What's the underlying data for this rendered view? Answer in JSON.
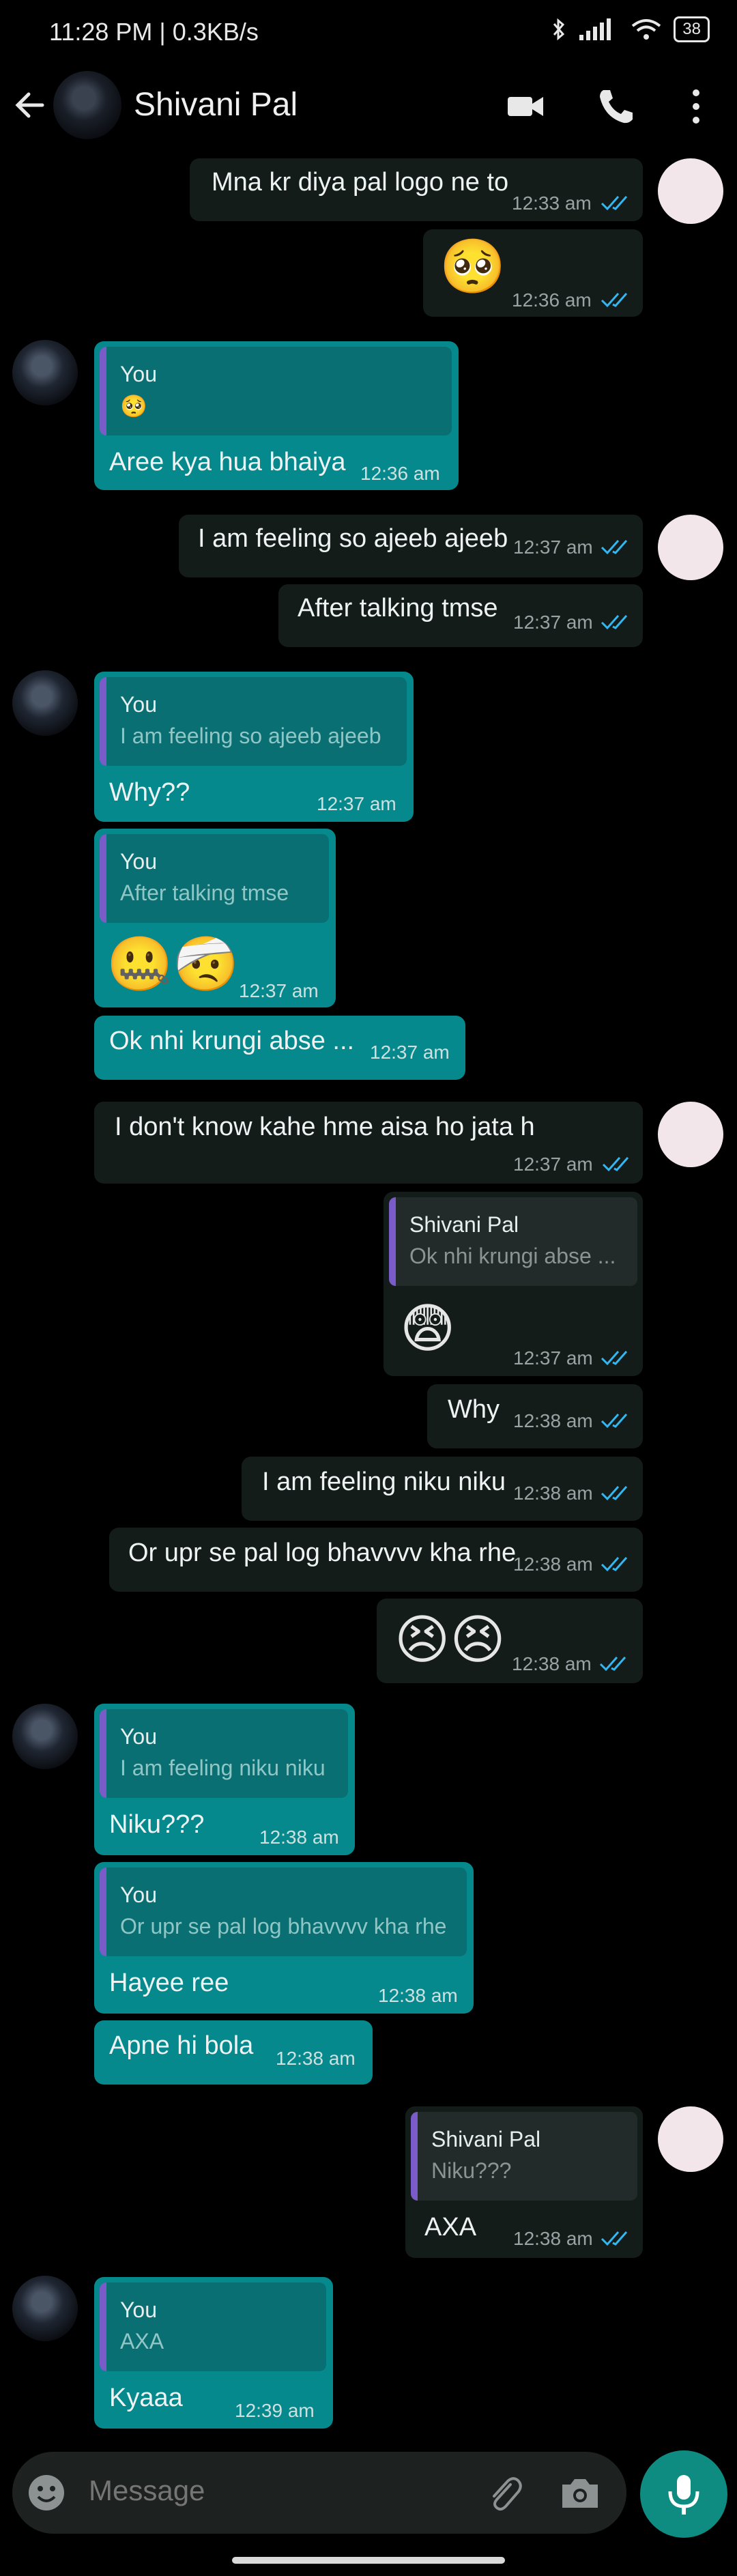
{
  "status_bar": {
    "time": "11:28 PM | 0.3KB/s",
    "battery": "38"
  },
  "header": {
    "contact_name": "Shivani Pal"
  },
  "messages": [
    {
      "text": "Mna kr diya pal logo ne to",
      "time": "12:33 am"
    },
    {
      "emoji": "🥺",
      "time": "12:36 am"
    },
    {
      "quote_name": "You",
      "quote_text": "🥺",
      "text": "Aree kya hua bhaiya",
      "time": "12:36 am"
    },
    {
      "text": "I am feeling so ajeeb ajeeb",
      "time": "12:37 am"
    },
    {
      "text": "After talking tmse",
      "time": "12:37 am"
    },
    {
      "quote_name": "You",
      "quote_text": "I am feeling so ajeeb ajeeb",
      "text": "Why??",
      "time": "12:37 am"
    },
    {
      "quote_name": "You",
      "quote_text": "After talking tmse",
      "emoji": "🤐🤕",
      "time": "12:37 am"
    },
    {
      "text": "Ok nhi krungi abse ...",
      "time": "12:37 am"
    },
    {
      "text": "I don't know kahe hme aisa ho jata h",
      "time": "12:37 am"
    },
    {
      "quote_name": "Shivani Pal",
      "quote_text": "Ok nhi krungi abse ...",
      "emoji": "😨",
      "time": "12:37 am"
    },
    {
      "text": "Why",
      "time": "12:38 am"
    },
    {
      "text": "I am feeling niku niku",
      "time": "12:38 am"
    },
    {
      "text": "Or upr se pal log bhavvvv kha rhe",
      "time": "12:38 am"
    },
    {
      "emoji": "😣😣",
      "time": "12:38 am"
    },
    {
      "quote_name": "You",
      "quote_text": "I am feeling niku niku",
      "text": "Niku???",
      "time": "12:38 am"
    },
    {
      "quote_name": "You",
      "quote_text": "Or upr se pal log bhavvvv kha rhe",
      "text": "Hayee ree",
      "time": "12:38 am"
    },
    {
      "text": "Apne hi bola",
      "time": "12:38 am"
    },
    {
      "quote_name": "Shivani Pal",
      "quote_text": "Niku???",
      "text": "AXA",
      "time": "12:38 am"
    },
    {
      "quote_name": "You",
      "quote_text": "AXA",
      "text": "Kyaaa",
      "time": "12:39 am"
    }
  ],
  "composer": {
    "placeholder": "Message"
  },
  "colors": {
    "incoming": "#05898c",
    "outgoing": "#141c1a",
    "ticks": "#34b7f1",
    "quote_bar": "#7a5cc9",
    "mic": "#0e8c82"
  }
}
